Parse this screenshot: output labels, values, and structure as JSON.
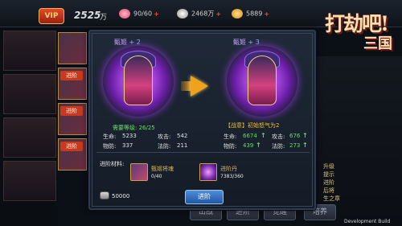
{
  "topbar": {
    "gold_value": "2525",
    "gold_unit": "万",
    "peach": "90/60",
    "silver": "2468万",
    "ingot": "5889"
  },
  "logo": {
    "big": "打劫吧!",
    "small": "三国"
  },
  "left_list": {
    "tags": [
      "进阶",
      "进阶",
      "进阶"
    ]
  },
  "right_panel": {
    "lines": [
      "升级",
      "提示",
      "进阶",
      "后将",
      "生之章"
    ]
  },
  "bg_tabs": [
    "出战",
    "进阶",
    "觉醒",
    "培养"
  ],
  "dialog": {
    "current": {
      "name": "甄姬",
      "level": "+ 2"
    },
    "next": {
      "name": "甄姬",
      "level": "+ 3"
    },
    "requirement": "需要等级: 26/25",
    "skill": "【战意】初始怒气为2",
    "stats_current": {
      "hp_label": "生命:",
      "hp": "5233",
      "atk_label": "攻击:",
      "atk": "542",
      "pdef_label": "物防:",
      "pdef": "337",
      "mdef_label": "法防:",
      "mdef": "211"
    },
    "stats_next": {
      "hp_label": "生命:",
      "hp": "6674",
      "atk_label": "攻击:",
      "atk": "676",
      "pdef_label": "物防:",
      "pdef": "439",
      "mdef_label": "法防:",
      "mdef": "273",
      "up_symbol": "↑"
    },
    "materials": {
      "title": "进阶材料:",
      "items": [
        {
          "name": "甄姬将魂",
          "count": "0/40"
        },
        {
          "name": "进阶丹",
          "count": "7383/360"
        }
      ]
    },
    "cost": "50000",
    "advance_button": "进阶"
  },
  "footer": {
    "dev_build": "Development Build"
  },
  "colors": {
    "accent": "#f0a21b",
    "up": "#5fe05a",
    "button": "#2f6cc0"
  }
}
